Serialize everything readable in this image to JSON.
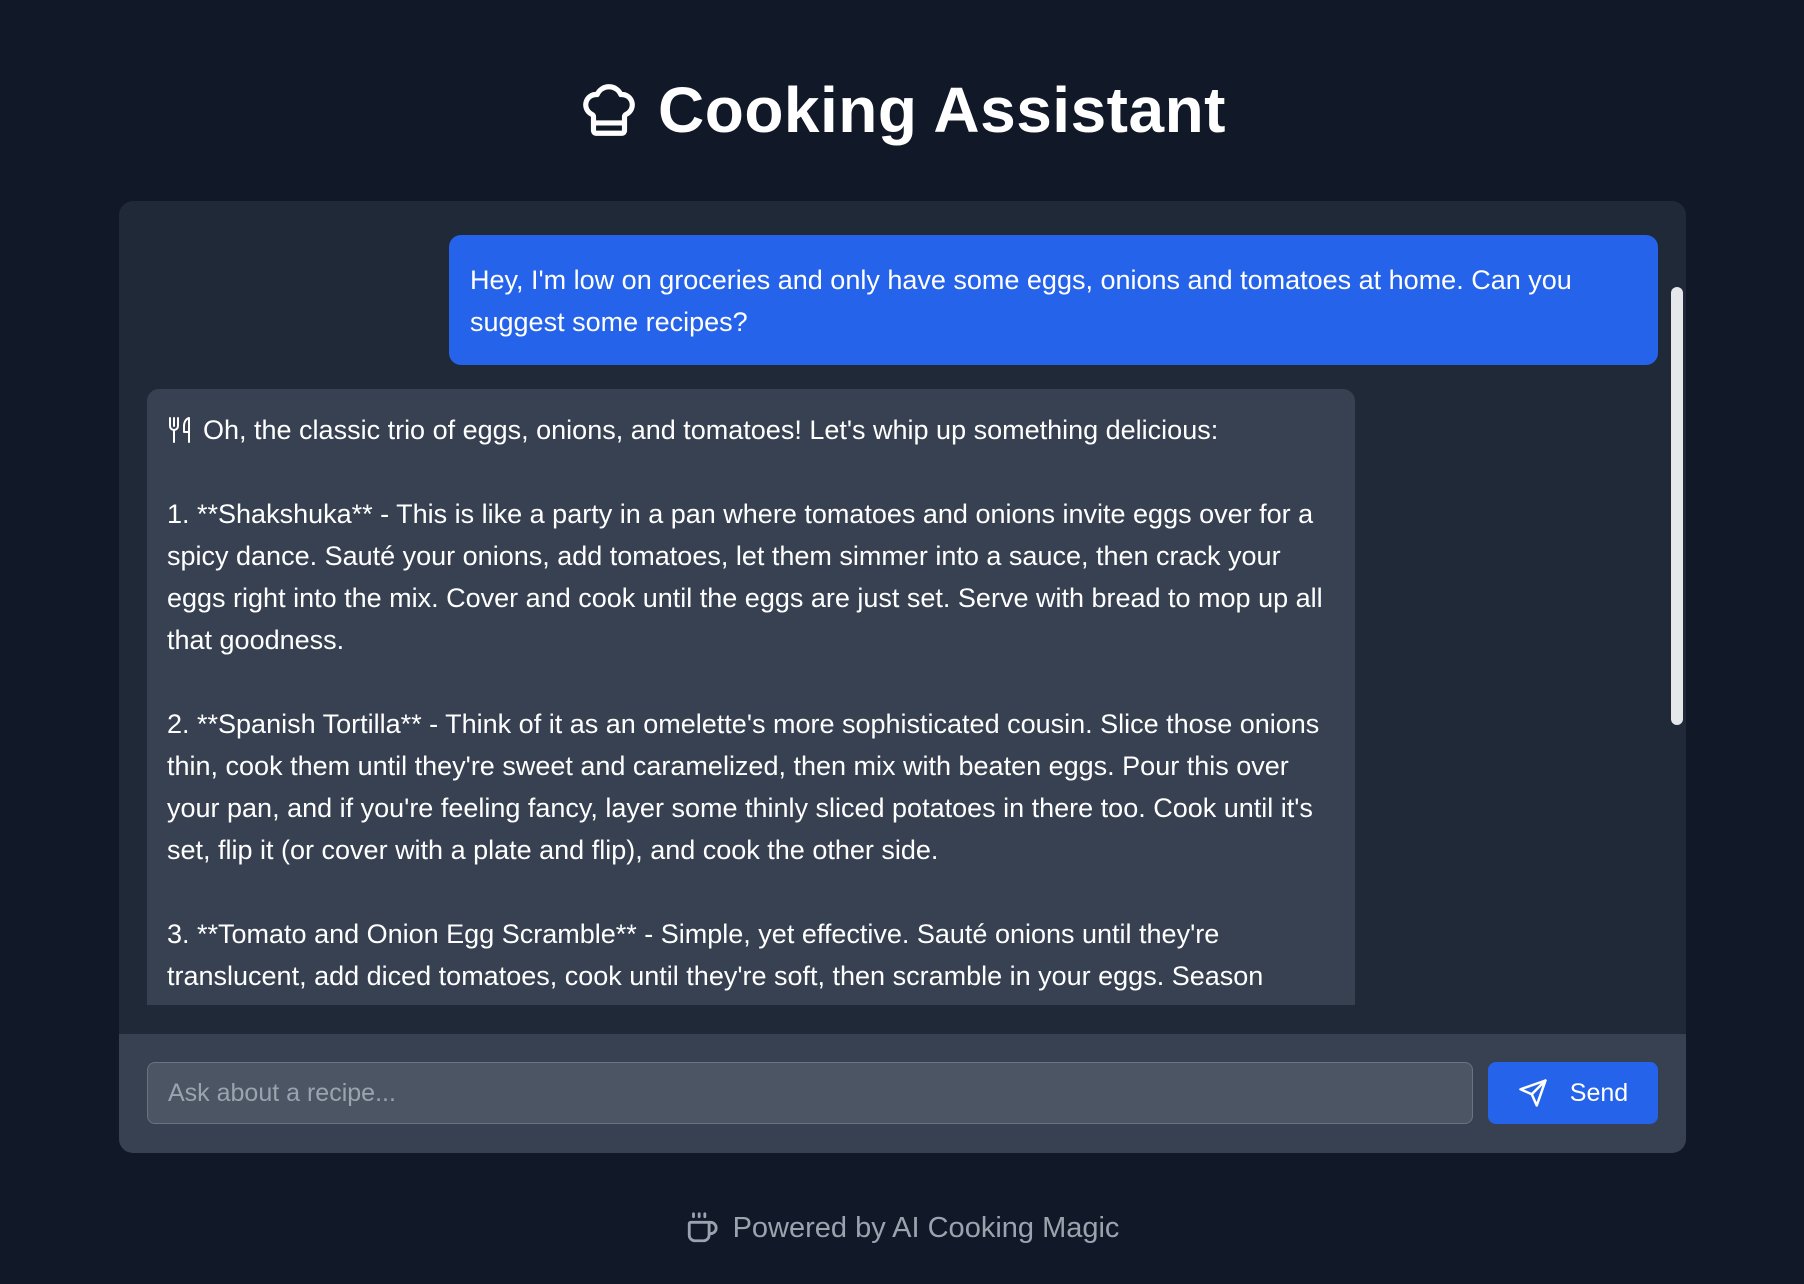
{
  "header": {
    "title": "Cooking Assistant",
    "icon": "chef-hat-icon"
  },
  "messages": [
    {
      "role": "user",
      "text": "Hey, I'm low on groceries and only have some eggs, onions and tomatoes at home. Can you suggest some recipes?"
    },
    {
      "role": "assistant",
      "icon": "utensils-icon",
      "text": "Oh, the classic trio of eggs, onions, and tomatoes! Let's whip up something delicious:\n\n1. **Shakshuka** - This is like a party in a pan where tomatoes and onions invite eggs over for a spicy dance. Sauté your onions, add tomatoes, let them simmer into a sauce, then crack your eggs right into the mix. Cover and cook until the eggs are just set. Serve with bread to mop up all that goodness.\n\n2. **Spanish Tortilla** - Think of it as an omelette's more sophisticated cousin. Slice those onions thin, cook them until they're sweet and caramelized, then mix with beaten eggs. Pour this over your pan, and if you're feeling fancy, layer some thinly sliced potatoes in there too. Cook until it's set, flip it (or cover with a plate and flip), and cook the other side.\n\n3. **Tomato and Onion Egg Scramble** - Simple, yet effective. Sauté onions until they're translucent, add diced tomatoes, cook until they're soft, then scramble in your eggs. Season"
    }
  ],
  "input": {
    "placeholder": "Ask about a recipe...",
    "value": ""
  },
  "send_button": {
    "label": "Send",
    "icon": "send-icon"
  },
  "footer": {
    "text": "Powered by AI Cooking Magic",
    "icon": "coffee-icon"
  },
  "colors": {
    "page_background": "#111827",
    "card_background": "#1f2937",
    "user_bubble": "#2563eb",
    "assistant_bubble": "#374151",
    "input_background": "#4b5563",
    "accent": "#2563eb",
    "muted_text": "#9ca3af"
  }
}
